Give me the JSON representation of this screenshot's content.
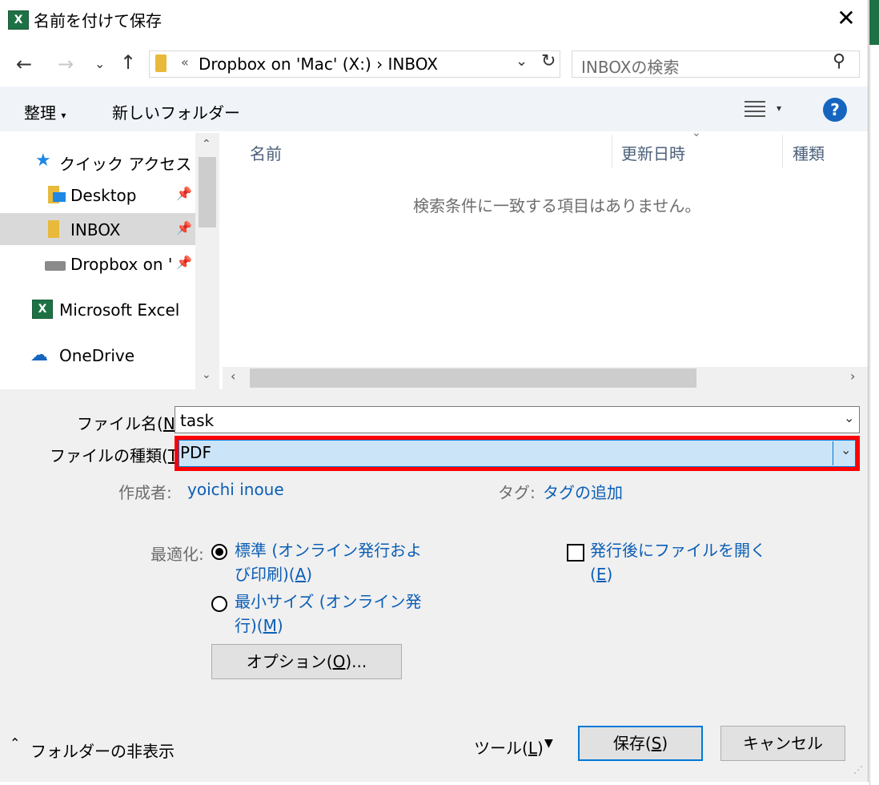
{
  "title": "名前を付けて保存",
  "nav": {
    "address_prefix": "«",
    "address_path": "Dropbox on 'Mac' (X:)",
    "address_separator": "›",
    "address_folder": "INBOX",
    "search_placeholder": "INBOXの検索"
  },
  "toolbar": {
    "organize": "整理",
    "new_folder": "新しいフォルダー"
  },
  "sidebar": {
    "quick_access": "クイック アクセス",
    "items": [
      {
        "label": "Desktop"
      },
      {
        "label": "INBOX"
      },
      {
        "label": "Dropbox on 'I"
      }
    ],
    "excel": "Microsoft Excel",
    "onedrive": "OneDrive"
  },
  "filelist": {
    "columns": [
      "名前",
      "更新日時",
      "種類"
    ],
    "empty_message": "検索条件に一致する項目はありません。"
  },
  "form": {
    "filename_label": "ファイル名(",
    "filename_key": "N",
    "filename_label_end": "):",
    "filename_value": "task",
    "filetype_label": "ファイルの種類(",
    "filetype_key": "T",
    "filetype_label_end": "):",
    "filetype_value": "PDF",
    "author_label": "作成者:",
    "author_value": "yoichi inoue",
    "tags_label": "タグ:",
    "tags_value": "タグの追加",
    "optimize_label": "最適化:",
    "opt_standard_line1": "標準 (オンライン発行およ",
    "opt_standard_line2": "び印刷)(",
    "opt_standard_key": "A",
    "opt_min_line1": "最小サイズ (オンライン発",
    "opt_min_line2": "行)(",
    "opt_min_key": "M",
    "open_after_line1": "発行後にファイルを開く",
    "open_after_key": "E",
    "options_button": "オプション(",
    "options_key": "O",
    "options_end": ")..."
  },
  "footer": {
    "hide_folders": "フォルダーの非表示",
    "tools": "ツール(",
    "tools_key": "L",
    "save": "保存(",
    "save_key": "S",
    "cancel": "キャンセル"
  },
  "colors": {
    "highlight_border": "#ff0000",
    "link": "#0b5eb5",
    "accent": "#0078d7"
  }
}
